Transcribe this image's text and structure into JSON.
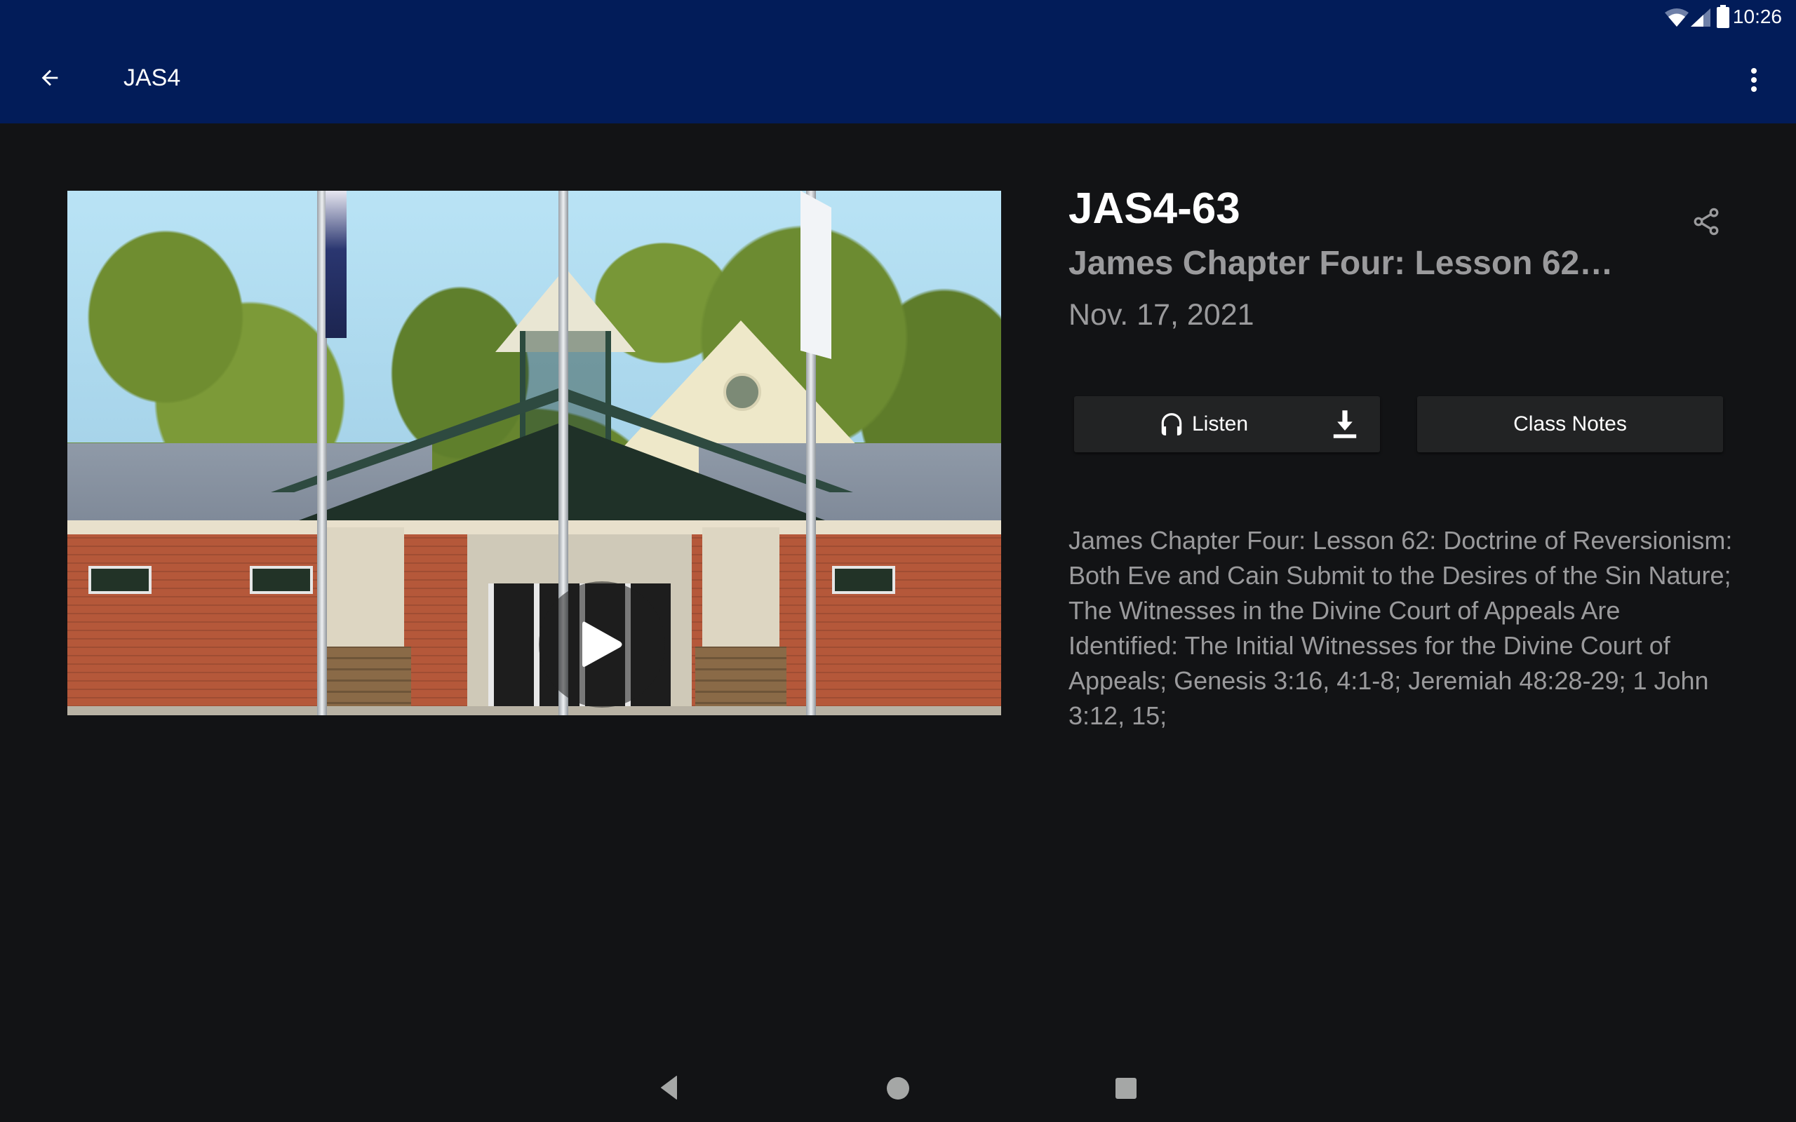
{
  "status_bar": {
    "time": "10:26",
    "icons": [
      "wifi-icon",
      "cellular-signal-icon",
      "battery-icon"
    ]
  },
  "app_bar": {
    "title": "JAS4",
    "back_icon": "arrow-back-icon",
    "menu_icon": "more-vert-icon",
    "color": "#021c59"
  },
  "media": {
    "thumbnail_alt": "Church building entrance with flag poles",
    "play_icon": "play-icon"
  },
  "lesson": {
    "code": "JAS4-63",
    "subtitle": "James Chapter Four: Lesson 62…",
    "date": "Nov. 17, 2021",
    "share_icon": "share-icon",
    "description": "James Chapter Four: Lesson 62: Doctrine of Reversionism: Both Eve and Cain Submit to the Desires of the Sin Nature; The Witnesses in the Divine Court of Appeals Are Identified: The Initial Witnesses for the Divine Court of Appeals; Genesis 3:16, 4:1-8; Jeremiah 48:28-29; 1 John 3:12, 15;"
  },
  "actions": {
    "listen_label": "Listen",
    "listen_icon": "headphones-icon",
    "download_icon": "download-icon",
    "class_notes_label": "Class Notes"
  },
  "nav_bar": {
    "buttons": [
      "back",
      "home",
      "recents"
    ]
  }
}
